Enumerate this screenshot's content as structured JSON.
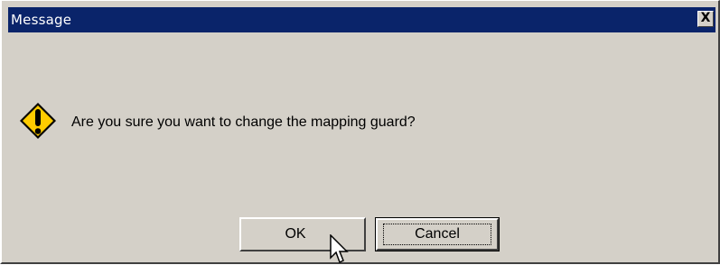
{
  "window": {
    "title": "Message",
    "close_symbol": "X"
  },
  "dialog": {
    "icon": "warning-icon",
    "message": "Are you sure you want to change the mapping guard?"
  },
  "buttons": {
    "ok_label": "OK",
    "cancel_label": "Cancel"
  },
  "colors": {
    "titlebar": "#0a246a",
    "face": "#d4d0c8",
    "warning_fill": "#ffcc00"
  }
}
